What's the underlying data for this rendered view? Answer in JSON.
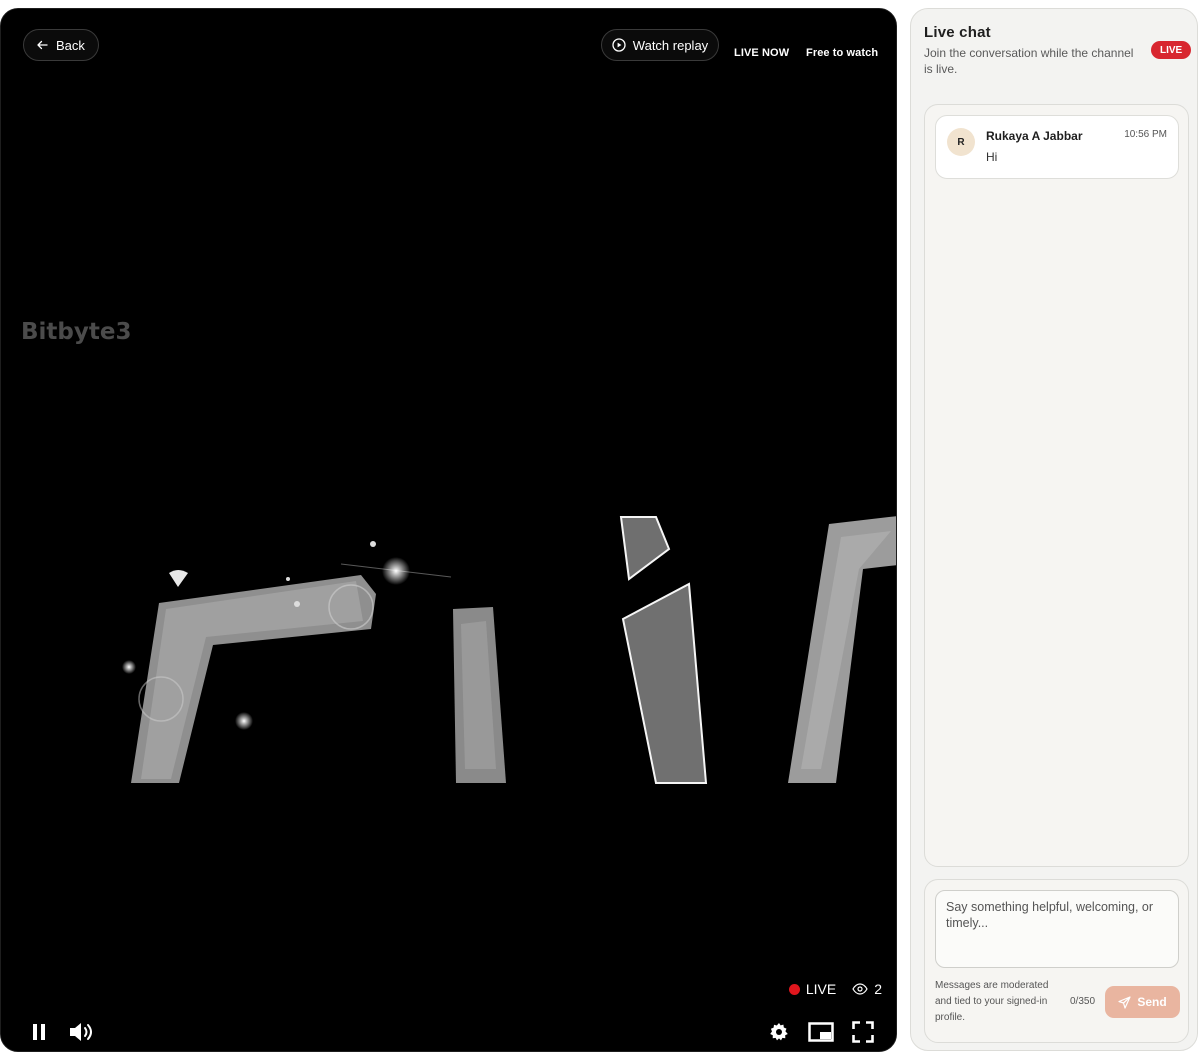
{
  "player": {
    "back_label": "Back",
    "watch_replay_label": "Watch replay",
    "live_now_label": "LIVE NOW",
    "free_label": "Free to watch",
    "watermark": "Bitbyte3",
    "live_indicator": "LIVE",
    "viewer_count": "2",
    "icons": [
      "arrow-left-icon",
      "play-circle-icon",
      "eye-icon",
      "pause-icon",
      "volume-icon",
      "gear-icon",
      "picture-in-picture-icon",
      "fullscreen-icon"
    ],
    "colors": {
      "live_dot": "#e0161d",
      "background": "#000000"
    }
  },
  "chat": {
    "title": "Live chat",
    "subtitle": "Join the conversation while the channel is live.",
    "badge": "LIVE",
    "messages": [
      {
        "initial": "R",
        "name": "Rukaya A Jabbar",
        "time": "10:56 PM",
        "text": "Hi"
      }
    ],
    "input_placeholder": "Say something helpful, welcoming, or timely...",
    "input_value": "",
    "moderation_note": "Messages are moderated and tied to your signed-in profile.",
    "char_counter": "0/350",
    "send_label": "Send",
    "colors": {
      "badge": "#d8262f",
      "send": "#e9b5a0",
      "avatar": "#f1e3cf"
    }
  }
}
